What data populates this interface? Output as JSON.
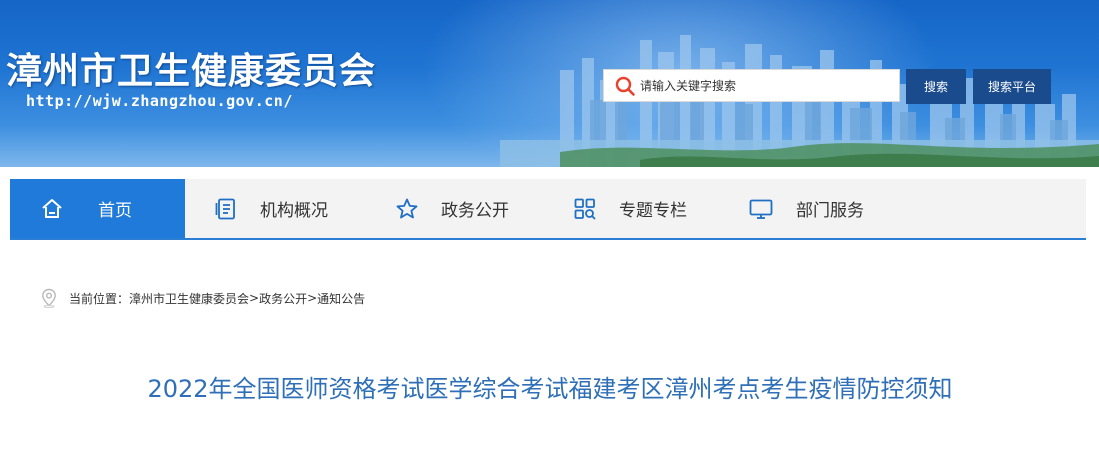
{
  "header": {
    "site_title": "漳州市卫生健康委员会",
    "site_url": "http://wjw.zhangzhou.gov.cn/",
    "search": {
      "placeholder": "请输入关键字搜索",
      "search_button": "搜索",
      "platform_button": "搜索平台"
    }
  },
  "nav": {
    "items": [
      {
        "label": "首页",
        "icon": "home-icon",
        "active": true
      },
      {
        "label": "机构概况",
        "icon": "document-list-icon",
        "active": false
      },
      {
        "label": "政务公开",
        "icon": "star-icon",
        "active": false
      },
      {
        "label": "专题专栏",
        "icon": "grid-search-icon",
        "active": false
      },
      {
        "label": "部门服务",
        "icon": "monitor-icon",
        "active": false
      }
    ]
  },
  "breadcrumb": {
    "icon": "location-pin-icon",
    "prefix": "当前位置：",
    "items": [
      "漳州市卫生健康委员会",
      "政务公开",
      "通知公告"
    ],
    "separator": ">"
  },
  "article": {
    "title": "2022年全国医师资格考试医学综合考试福建考区漳州考点考生疫情防控须知"
  },
  "colors": {
    "banner_blue": "#1f74d2",
    "nav_active": "#1f7ad9",
    "button_dark": "#1a4b8c",
    "title_blue": "#2e6fb7",
    "search_icon": "#e8412c"
  }
}
